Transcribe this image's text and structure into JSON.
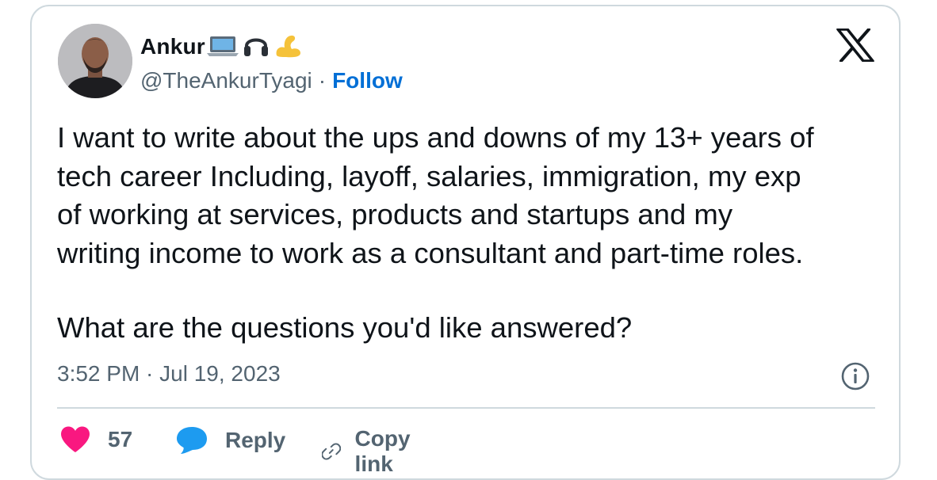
{
  "author": {
    "name": "Ankur",
    "name_emojis": "💻🎧💪",
    "handle": "@TheAnkurTyagi",
    "separator": "·",
    "follow_label": "Follow"
  },
  "tweet": {
    "text": "I want to write about the ups and downs of my 13+ years of\ntech career Including, layoff, salaries, immigration, my exp\nof working at services, products and startups and my\nwriting income to work as a consultant and part-time roles.",
    "question": "What are the questions you'd like answered?",
    "timestamp": "3:52 PM · Jul 19, 2023"
  },
  "actions": {
    "like_count": "57",
    "reply_label": "Reply",
    "copy_link_label": "Copy link"
  },
  "colors": {
    "accent": "#006fd6",
    "muted": "#536471",
    "like": "#f91880",
    "reply": "#1d9bf0",
    "border": "#cfd9de"
  },
  "icons": [
    "x-logo-icon",
    "info-icon",
    "heart-icon",
    "reply-bubble-icon",
    "link-icon"
  ]
}
